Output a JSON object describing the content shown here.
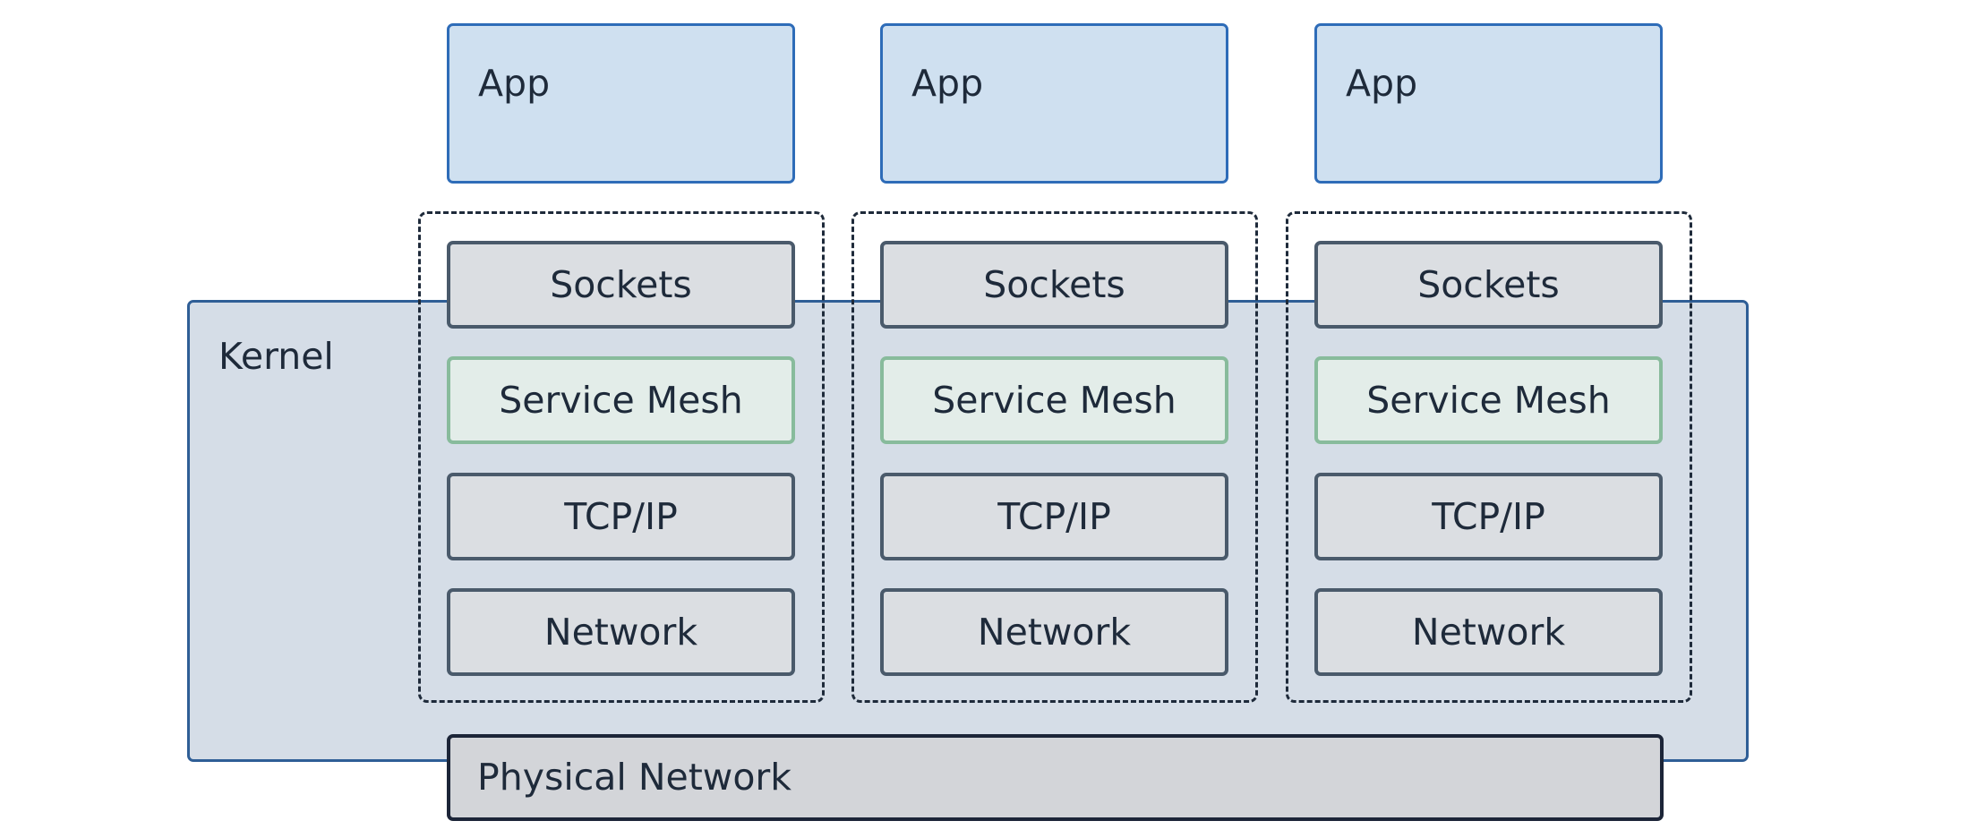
{
  "kernel": {
    "label": "Kernel"
  },
  "physical": {
    "label": "Physical Network"
  },
  "columns": [
    {
      "app": "App",
      "layers": [
        "Sockets",
        "Service Mesh",
        "TCP/IP",
        "Network"
      ]
    },
    {
      "app": "App",
      "layers": [
        "Sockets",
        "Service Mesh",
        "TCP/IP",
        "Network"
      ]
    },
    {
      "app": "App",
      "layers": [
        "Sockets",
        "Service Mesh",
        "TCP/IP",
        "Network"
      ]
    }
  ],
  "colors": {
    "app_border": "#2e6cb8",
    "kernel_border": "#2f5e96",
    "mesh_border": "#88bb9c"
  }
}
